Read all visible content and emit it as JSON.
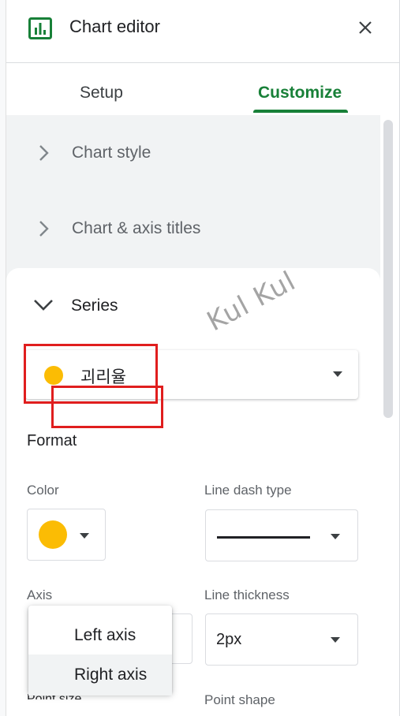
{
  "header": {
    "title": "Chart editor",
    "icon": "chart-icon",
    "close_icon": "close-icon"
  },
  "tabs": [
    {
      "label": "Setup",
      "active": false
    },
    {
      "label": "Customize",
      "active": true
    }
  ],
  "sections": {
    "chart_style": "Chart style",
    "chart_axis_titles": "Chart & axis titles",
    "series": "Series"
  },
  "series_select": {
    "selected": "괴리율",
    "color": "#fbbc04"
  },
  "format": {
    "title": "Format",
    "color_label": "Color",
    "color_value": "#fbbc04",
    "line_dash_label": "Line dash type",
    "axis_label": "Axis",
    "line_thickness_label": "Line thickness",
    "line_thickness_value": "2px",
    "point_shape_label": "Point shape",
    "point_size_label": "Point size"
  },
  "axis_dropdown": {
    "options": [
      "Left axis",
      "Right axis"
    ],
    "selected": "Right axis"
  },
  "watermark": "Kul Kul",
  "colors": {
    "accent": "#188038",
    "highlight": "#e01e1e",
    "series": "#fbbc04"
  }
}
